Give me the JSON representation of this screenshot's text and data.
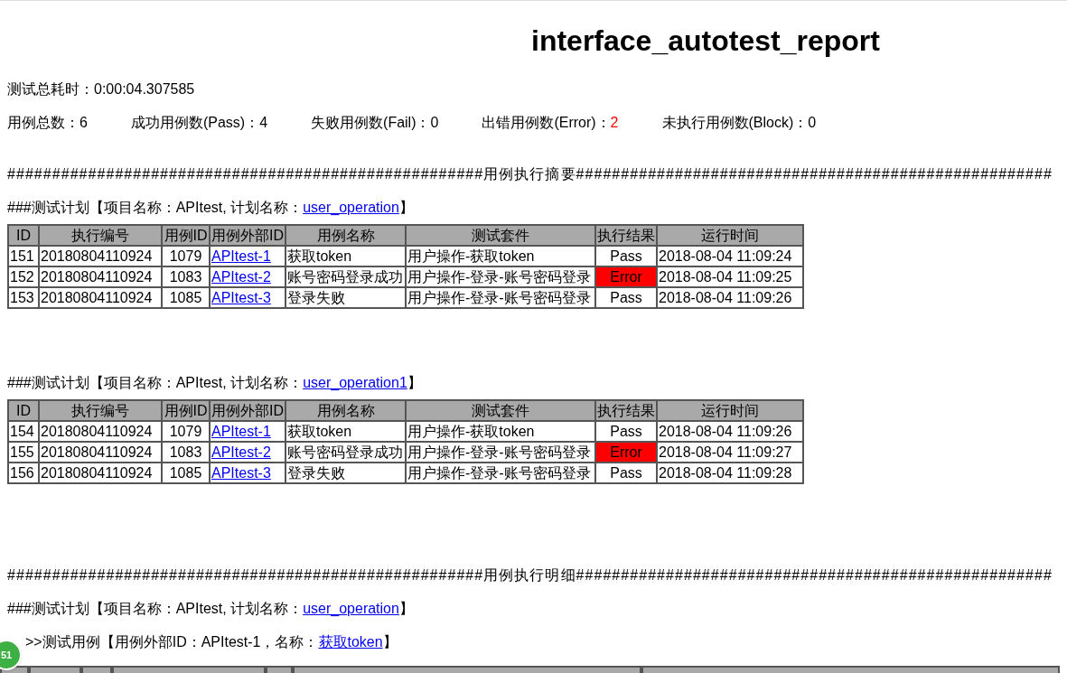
{
  "title": "interface_autotest_report",
  "duration": {
    "label": "测试总耗时：",
    "value": "0:00:04.307585"
  },
  "counts": [
    {
      "label": "用例总数：",
      "value": "6",
      "alert": false
    },
    {
      "label": "成功用例数(Pass)：",
      "value": "4",
      "alert": false
    },
    {
      "label": "失败用例数(Fail)：",
      "value": "0",
      "alert": false
    },
    {
      "label": "出错用例数(Error)：",
      "value": "2",
      "alert": true
    },
    {
      "label": "未执行用例数(Block)：",
      "value": "0",
      "alert": false
    }
  ],
  "summary_heading": "#####################################################用例执行摘要#####################################################",
  "plans": [
    {
      "prefix": "###测试计划【项目名称：APItest, 计划名称：",
      "link": "user_operation",
      "suffix": "】",
      "columns": [
        "ID",
        "执行编号",
        "用例ID",
        "用例外部ID",
        "用例名称",
        "测试套件",
        "执行结果",
        "运行时间"
      ],
      "rows": [
        {
          "cells": [
            "151",
            "20180804110924",
            "1079",
            "APItest-1",
            "获取token",
            "用户操作-获取token",
            "Pass",
            "2018-08-04 11:09:24"
          ],
          "error": false
        },
        {
          "cells": [
            "152",
            "20180804110924",
            "1083",
            "APItest-2",
            "账号密码登录成功",
            "用户操作-登录-账号密码登录",
            "Error",
            "2018-08-04 11:09:25"
          ],
          "error": true
        },
        {
          "cells": [
            "153",
            "20180804110924",
            "1085",
            "APItest-3",
            "登录失败",
            "用户操作-登录-账号密码登录",
            "Pass",
            "2018-08-04 11:09:26"
          ],
          "error": false
        }
      ]
    },
    {
      "prefix": "###测试计划【项目名称：APItest, 计划名称：",
      "link": "user_operation1",
      "suffix": "】",
      "columns": [
        "ID",
        "执行编号",
        "用例ID",
        "用例外部ID",
        "用例名称",
        "测试套件",
        "执行结果",
        "运行时间"
      ],
      "rows": [
        {
          "cells": [
            "154",
            "20180804110924",
            "1079",
            "APItest-1",
            "获取token",
            "用户操作-获取token",
            "Pass",
            "2018-08-04 11:09:26"
          ],
          "error": false
        },
        {
          "cells": [
            "155",
            "20180804110924",
            "1083",
            "APItest-2",
            "账号密码登录成功",
            "用户操作-登录-账号密码登录",
            "Error",
            "2018-08-04 11:09:27"
          ],
          "error": true
        },
        {
          "cells": [
            "156",
            "20180804110924",
            "1085",
            "APItest-3",
            "登录失败",
            "用户操作-登录-账号密码登录",
            "Pass",
            "2018-08-04 11:09:28"
          ],
          "error": false
        }
      ]
    }
  ],
  "detail_heading": "#####################################################用例执行明细#####################################################",
  "detail_plan": {
    "prefix": "###测试计划【项目名称：APItest, 计划名称：",
    "link": "user_operation",
    "suffix": "】"
  },
  "detail_case": {
    "prefix": ">>测试用例【用例外部ID：APItest-1，名称：",
    "link": "获取token",
    "suffix": "】"
  },
  "badge": "51"
}
